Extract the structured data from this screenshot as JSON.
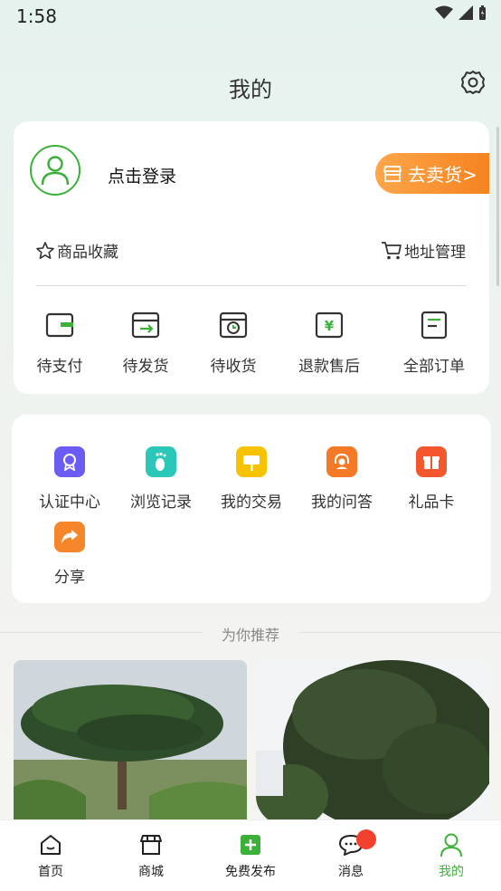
{
  "status_bar": {
    "time": "1:58"
  },
  "header": {
    "title": "我的"
  },
  "user_card": {
    "login_text": "点击登录",
    "sell_button": "去卖货>",
    "favorites_label": "商品收藏",
    "address_label": "地址管理",
    "orders": [
      {
        "label": "待支付",
        "icon": "wallet-icon"
      },
      {
        "label": "待发货",
        "icon": "package-send-icon"
      },
      {
        "label": "待收货",
        "icon": "box-clock-icon"
      },
      {
        "label": "退款售后",
        "icon": "refund-yen-icon"
      },
      {
        "label": "全部订单",
        "icon": "orders-list-icon"
      }
    ]
  },
  "tools": {
    "items": [
      {
        "label": "认证中心",
        "icon": "certification-icon",
        "color": "#6a5cf5"
      },
      {
        "label": "浏览记录",
        "icon": "footprint-icon",
        "color": "#2bc7b8"
      },
      {
        "label": "我的交易",
        "icon": "signboard-icon",
        "color": "#f7c300"
      },
      {
        "label": "我的问答",
        "icon": "headset-icon",
        "color": "#f57a28"
      },
      {
        "label": "礼品卡",
        "icon": "gift-icon",
        "color": "#f4562d"
      },
      {
        "label": "分享",
        "icon": "share-icon",
        "color": "#f5872a"
      }
    ]
  },
  "recommend": {
    "title": "为你推荐"
  },
  "bottom_nav": {
    "items": [
      {
        "label": "首页",
        "icon": "home-icon"
      },
      {
        "label": "商城",
        "icon": "store-icon"
      },
      {
        "label": "免费发布",
        "icon": "publish-plus-icon"
      },
      {
        "label": "消息",
        "icon": "message-icon"
      },
      {
        "label": "我的",
        "icon": "profile-icon"
      }
    ],
    "active": "我的"
  },
  "colors": {
    "accent": "#3cb13a",
    "orange": "#f58320",
    "badge": "#f2402e"
  }
}
